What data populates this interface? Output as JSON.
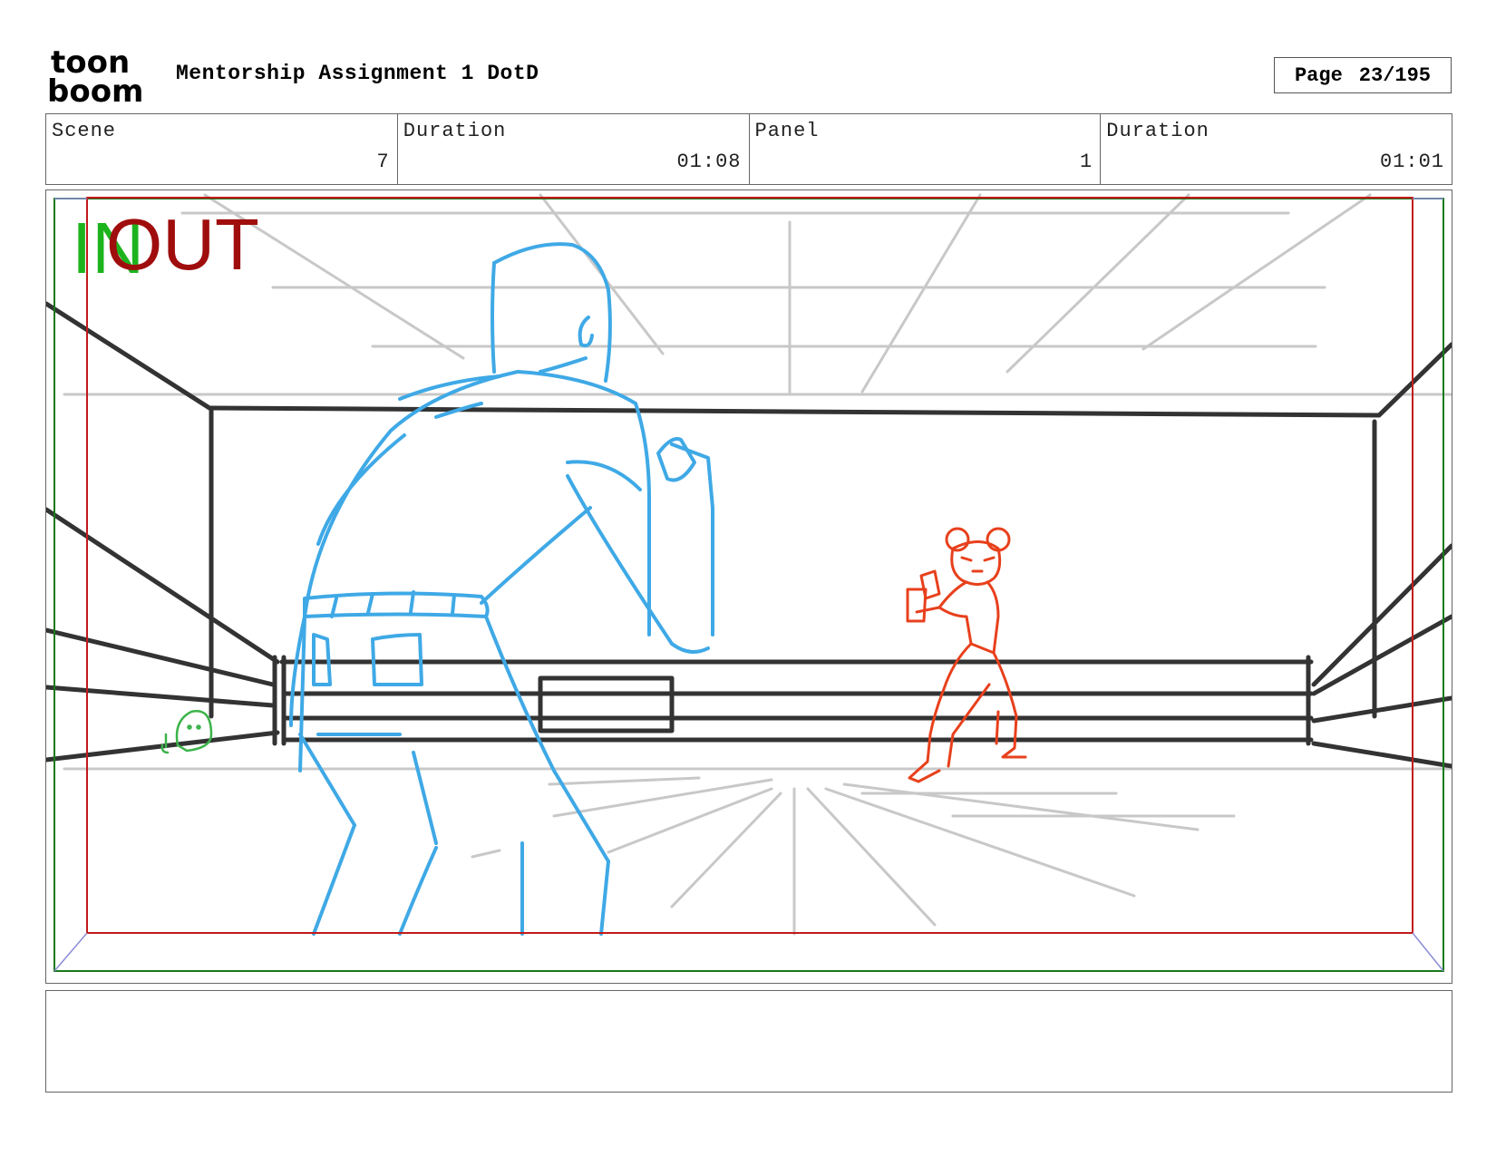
{
  "header": {
    "logo_text_top": "toon",
    "logo_text_bottom": "boom",
    "title": "Mentorship Assignment 1 DotD",
    "page_label": "Page",
    "page_value": "23/195"
  },
  "info": {
    "scene_label": "Scene",
    "scene_value": "7",
    "scene_duration_label": "Duration",
    "scene_duration_value": "01:08",
    "panel_label": "Panel",
    "panel_value": "1",
    "panel_duration_label": "Duration",
    "panel_duration_value": "01:01"
  },
  "panel": {
    "in_label": "IN",
    "out_label": "OUT",
    "colors": {
      "in_marker": "#1db31d",
      "out_marker": "#a00d0d",
      "foreground_character": "#3fa9e6",
      "background_character": "#e8401c",
      "small_character": "#3cb34a",
      "ring_lines": "#333333",
      "perspective_lines": "#c8c8c8"
    }
  },
  "notes": {
    "text": ""
  }
}
